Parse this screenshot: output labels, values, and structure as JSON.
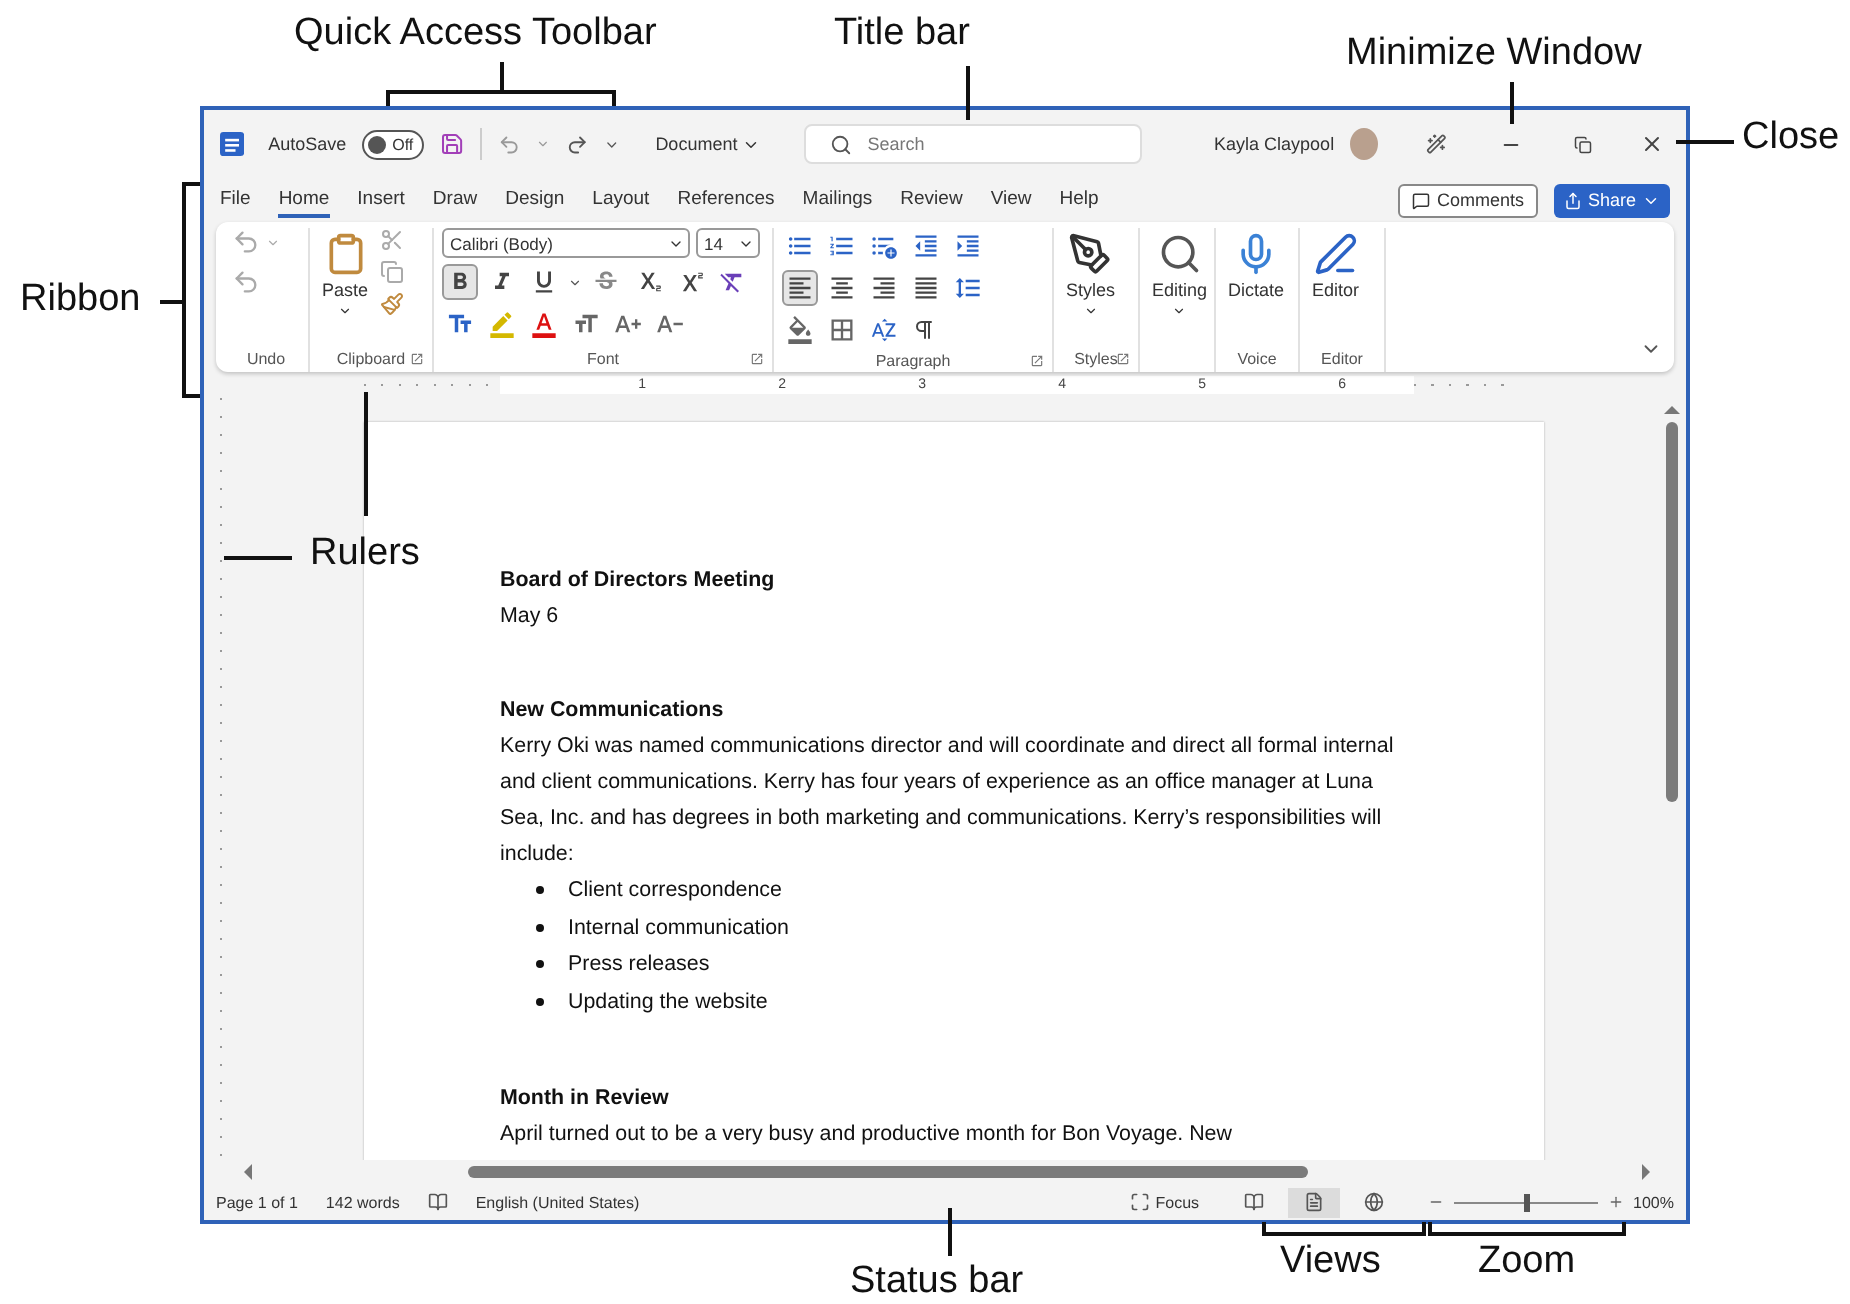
{
  "callouts": [
    {
      "kind": "qat",
      "text": "Quick Access Toolbar"
    },
    {
      "kind": "title",
      "text": "Title bar"
    },
    {
      "kind": "minimize",
      "text": "Minimize Window"
    },
    {
      "kind": "close",
      "text": "Close"
    },
    {
      "kind": "ribbon",
      "text": "Ribbon"
    },
    {
      "kind": "rulers",
      "text": "Rulers"
    },
    {
      "kind": "status",
      "text": "Status bar"
    },
    {
      "kind": "views",
      "text": "Views"
    },
    {
      "kind": "zoom",
      "text": "Zoom"
    }
  ],
  "title_bar": {
    "autosave_label": "AutoSave",
    "autosave_on": false,
    "autosave_state": "Off",
    "document_name": "Document",
    "search_placeholder": "Search",
    "user": "Kayla Claypool"
  },
  "ribbon_tabs": [
    {
      "label": "File",
      "selected": false
    },
    {
      "label": "Home",
      "selected": true
    },
    {
      "label": "Insert",
      "selected": false
    },
    {
      "label": "Draw",
      "selected": false
    },
    {
      "label": "Design",
      "selected": false
    },
    {
      "label": "Layout",
      "selected": false
    },
    {
      "label": "References",
      "selected": false
    },
    {
      "label": "Mailings",
      "selected": false
    },
    {
      "label": "Review",
      "selected": false
    },
    {
      "label": "View",
      "selected": false
    },
    {
      "label": "Help",
      "selected": false
    }
  ],
  "comments_button": "Comments",
  "share_button": "Share",
  "ribbon": {
    "paste": "Paste",
    "font_name": "Calibri (Body)",
    "font_size": "14",
    "bold_selected": true,
    "align_left_selected": true,
    "styles": "Styles",
    "editing": "Editing",
    "dictate": "Dictate",
    "editor": "Editor",
    "groups": [
      "Undo",
      "Clipboard",
      "Font",
      "Paragraph",
      "Styles",
      "Voice",
      "Editor"
    ]
  },
  "ruler_numbers": [
    "1",
    "2",
    "3",
    "4",
    "5",
    "6"
  ],
  "document": {
    "title": "Board of Directors Meeting",
    "date": "May 6",
    "heading": "New Communications",
    "paragraph": "Kerry Oki was named communications director and will coordinate and direct all formal internal and client communications. Kerry has four years of experience as an office manager at Luna Sea, Inc. and has degrees in both marketing and communications. Kerry’s responsibilities will include:",
    "bullets": [
      "Client correspondence",
      "Internal communication",
      "Press releases",
      "Updating the website"
    ],
    "heading_2": "Month in Review",
    "paragraph_2": "April turned out to be a very busy and productive month for Bon Voyage. New"
  },
  "status_bar": {
    "page": "Page 1 of 1",
    "words": "142 words",
    "language": "English (United States)",
    "focus": "Focus",
    "zoom": "100%",
    "zoom_slider": {
      "level": 0.5
    },
    "views": [
      {
        "kind": "read",
        "selected": false
      },
      {
        "kind": "print",
        "selected": true
      },
      {
        "kind": "web",
        "selected": false
      }
    ]
  }
}
